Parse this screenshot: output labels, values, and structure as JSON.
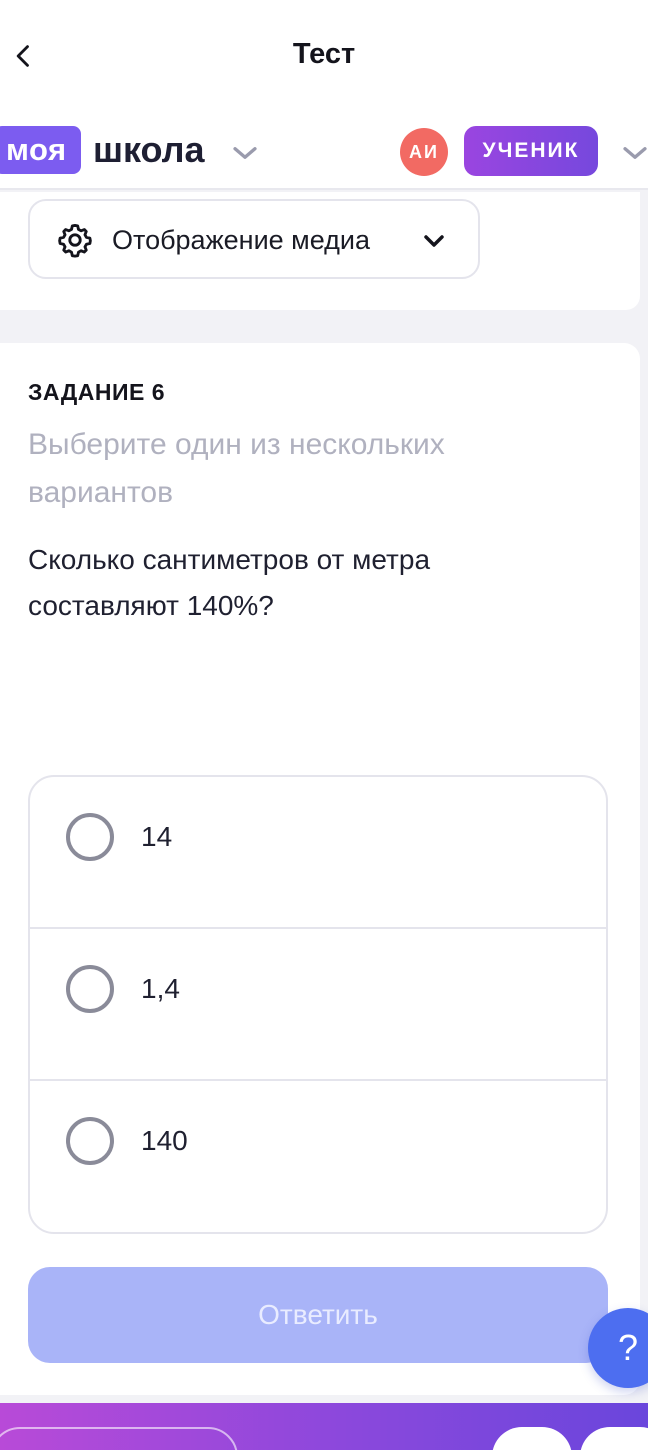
{
  "header": {
    "title": "Тест",
    "back_icon": "chevron-left-icon"
  },
  "brand": {
    "pill_text": "моя",
    "word_text": "школа",
    "avatar_initials": "АИ",
    "role_label": "УЧЕНИК",
    "colors": {
      "brand": "#7c5cf0",
      "avatar": "#f26a63",
      "role_from": "#9a45e0",
      "role_to": "#7648dd"
    }
  },
  "media": {
    "label": "Отображение медиа",
    "icon": "gear-icon"
  },
  "task": {
    "label": "ЗАДАНИЕ 6",
    "hint": "Выберите один из нескольких вариантов",
    "question": "Сколько сантиметров от метра составляют 140%?",
    "options": [
      {
        "label": "14",
        "selected": false
      },
      {
        "label": "1,4",
        "selected": false
      },
      {
        "label": "140",
        "selected": false
      }
    ],
    "submit_label": "Ответить"
  },
  "help": {
    "label": "?"
  }
}
